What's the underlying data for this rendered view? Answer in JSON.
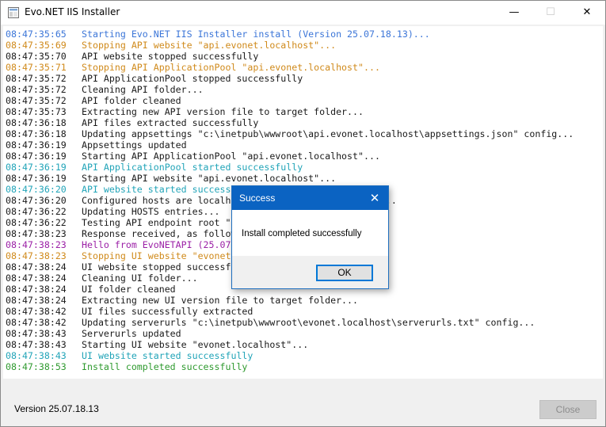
{
  "window": {
    "title": "Evo.NET IIS Installer",
    "controls": {
      "minimize": "—",
      "maximize": "☐",
      "close": "✕"
    }
  },
  "colors": {
    "blue": "#3c76d8",
    "orange": "#d08a1b",
    "black": "#1a1a1a",
    "teal": "#21a4b8",
    "purple": "#9b1fa6",
    "green": "#2f9a2f"
  },
  "log": [
    {
      "time": "08:47:35:65",
      "msg": "Starting Evo.NET IIS Installer install (Version 25.07.18.13)...",
      "color": "blue"
    },
    {
      "time": "08:47:35:69",
      "msg": "Stopping API website \"api.evonet.localhost\"...",
      "color": "orange"
    },
    {
      "time": "08:47:35:70",
      "msg": "API website stopped successfully",
      "color": "black"
    },
    {
      "time": "08:47:35:71",
      "msg": "Stopping API ApplicationPool \"api.evonet.localhost\"...",
      "color": "orange"
    },
    {
      "time": "08:47:35:72",
      "msg": "API ApplicationPool stopped successfully",
      "color": "black"
    },
    {
      "time": "08:47:35:72",
      "msg": "Cleaning API folder...",
      "color": "black"
    },
    {
      "time": "08:47:35:72",
      "msg": "API folder cleaned",
      "color": "black"
    },
    {
      "time": "08:47:35:73",
      "msg": "Extracting new API version file to target folder...",
      "color": "black"
    },
    {
      "time": "08:47:36:18",
      "msg": "API files extracted successfully",
      "color": "black"
    },
    {
      "time": "08:47:36:18",
      "msg": "Updating appsettings \"c:\\inetpub\\wwwroot\\api.evonet.localhost\\appsettings.json\" config...",
      "color": "black"
    },
    {
      "time": "08:47:36:19",
      "msg": "Appsettings updated",
      "color": "black"
    },
    {
      "time": "08:47:36:19",
      "msg": "Starting API ApplicationPool \"api.evonet.localhost\"...",
      "color": "black"
    },
    {
      "time": "08:47:36:19",
      "msg": "API ApplicationPool started successfully",
      "color": "teal"
    },
    {
      "time": "08:47:36:19",
      "msg": "Starting API website \"api.evonet.localhost\"...",
      "color": "black"
    },
    {
      "time": "08:47:36:20",
      "msg": "API website started successfully",
      "color": "teal"
    },
    {
      "time": "08:47:36:20",
      "msg": "Configured hosts are localhost, updating HOSTS entries...",
      "color": "black"
    },
    {
      "time": "08:47:36:22",
      "msg": "Updating HOSTS entries...",
      "color": "black"
    },
    {
      "time": "08:47:36:22",
      "msg": "Testing API endpoint root \"...",
      "color": "black"
    },
    {
      "time": "08:47:38:23",
      "msg": "Response received, as follows:",
      "color": "black"
    },
    {
      "time": "08:47:38:23",
      "msg": "Hello from EvoNETAPI (25.07.18.13) at 08:47:38 AM",
      "color": "purple"
    },
    {
      "time": "08:47:38:23",
      "msg": "Stopping UI website \"evonet.localhost\"...",
      "color": "orange"
    },
    {
      "time": "08:47:38:24",
      "msg": "UI website stopped successfully",
      "color": "black"
    },
    {
      "time": "08:47:38:24",
      "msg": "Cleaning UI folder...",
      "color": "black"
    },
    {
      "time": "08:47:38:24",
      "msg": "UI folder cleaned",
      "color": "black"
    },
    {
      "time": "08:47:38:24",
      "msg": "Extracting new UI version file to target folder...",
      "color": "black"
    },
    {
      "time": "08:47:38:42",
      "msg": "UI files successfully extracted",
      "color": "black"
    },
    {
      "time": "08:47:38:42",
      "msg": "Updating serverurls \"c:\\inetpub\\wwwroot\\evonet.localhost\\serverurls.txt\" config...",
      "color": "black"
    },
    {
      "time": "08:47:38:43",
      "msg": "Serverurls updated",
      "color": "black"
    },
    {
      "time": "08:47:38:43",
      "msg": "Starting UI website \"evonet.localhost\"...",
      "color": "black"
    },
    {
      "time": "08:47:38:43",
      "msg": "UI website started successfully",
      "color": "teal"
    },
    {
      "time": "08:47:38:53",
      "msg": "Install completed successfully",
      "color": "green"
    }
  ],
  "footer": {
    "version": "Version 25.07.18.13",
    "close_label": "Close"
  },
  "dialog": {
    "title": "Success",
    "close_icon": "✕",
    "message": "Install completed successfully",
    "ok_label": "OK"
  }
}
